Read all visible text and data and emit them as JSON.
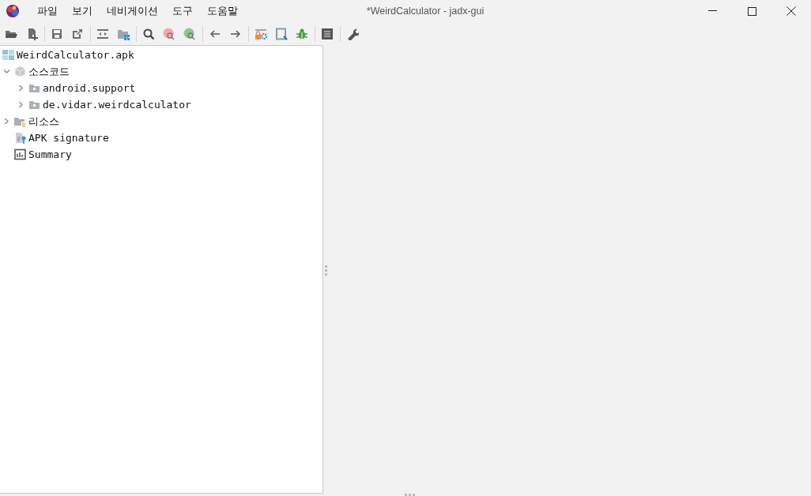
{
  "window": {
    "title": "*WeirdCalculator - jadx-gui"
  },
  "menu": [
    {
      "label": "파일"
    },
    {
      "label": "보기"
    },
    {
      "label": "네비게이션"
    },
    {
      "label": "도구"
    },
    {
      "label": "도움말"
    }
  ],
  "toolbar": [
    {
      "kind": "open"
    },
    {
      "kind": "add"
    },
    {
      "kind": "sep"
    },
    {
      "kind": "save"
    },
    {
      "kind": "export"
    },
    {
      "kind": "sep"
    },
    {
      "kind": "sync"
    },
    {
      "kind": "flatten"
    },
    {
      "kind": "sep"
    },
    {
      "kind": "search"
    },
    {
      "kind": "find-class"
    },
    {
      "kind": "find-usage"
    },
    {
      "kind": "sep"
    },
    {
      "kind": "back"
    },
    {
      "kind": "forward"
    },
    {
      "kind": "sep"
    },
    {
      "kind": "deobf"
    },
    {
      "kind": "quark"
    },
    {
      "kind": "debug"
    },
    {
      "kind": "sep"
    },
    {
      "kind": "log"
    },
    {
      "kind": "sep"
    },
    {
      "kind": "prefs"
    }
  ],
  "tree": [
    {
      "label": "WeirdCalculator.apk",
      "kind": "apk",
      "children": [
        {
          "label": "소스코드",
          "kind": "source",
          "expanded": true,
          "children": [
            {
              "label": "android.support",
              "kind": "package",
              "expanded": false
            },
            {
              "label": "de.vidar.weirdcalculator",
              "kind": "package",
              "expanded": false
            }
          ]
        },
        {
          "label": "리소스",
          "kind": "resources",
          "expanded": false
        },
        {
          "label": "APK signature",
          "kind": "signature"
        },
        {
          "label": "Summary",
          "kind": "summary"
        }
      ]
    }
  ]
}
